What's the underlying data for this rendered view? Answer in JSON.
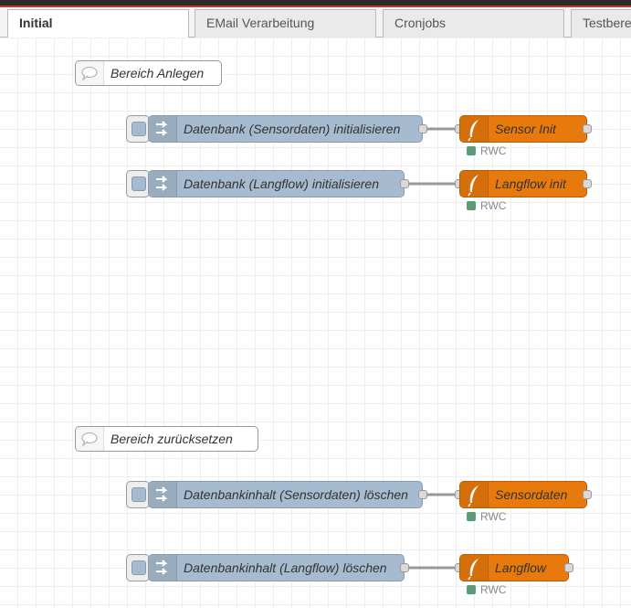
{
  "colors": {
    "inject": "#a6bbcf",
    "function": "#e8790c",
    "status_ok": "#5a9c76",
    "wire": "#999999"
  },
  "tabs": [
    {
      "label": "Initial",
      "active": true
    },
    {
      "label": "EMail Verarbeitung",
      "active": false
    },
    {
      "label": "Cronjobs",
      "active": false
    },
    {
      "label": "Testbere",
      "active": false
    }
  ],
  "comments": [
    {
      "label": "Bereich Anlegen",
      "icon": "comment-icon"
    },
    {
      "label": "Bereich zurücksetzen",
      "icon": "comment-icon"
    }
  ],
  "inject_nodes": [
    {
      "label": "Datenbank (Sensordaten) initialisieren",
      "icon": "inject-arrow-icon"
    },
    {
      "label": "Datenbank (Langflow) initialisieren",
      "icon": "inject-arrow-icon"
    },
    {
      "label": "Datenbankinhalt (Sensordaten) löschen",
      "icon": "inject-arrow-icon"
    },
    {
      "label": "Datenbankinhalt (Langflow) löschen",
      "icon": "inject-arrow-icon"
    }
  ],
  "function_nodes": [
    {
      "label": "Sensor Init",
      "status": "RWC",
      "icon": "feather-icon"
    },
    {
      "label": "Langflow init",
      "status": "RWC",
      "icon": "feather-icon"
    },
    {
      "label": "Sensordaten",
      "status": "RWC",
      "icon": "feather-icon"
    },
    {
      "label": "Langflow",
      "status": "RWC",
      "icon": "feather-icon"
    }
  ]
}
